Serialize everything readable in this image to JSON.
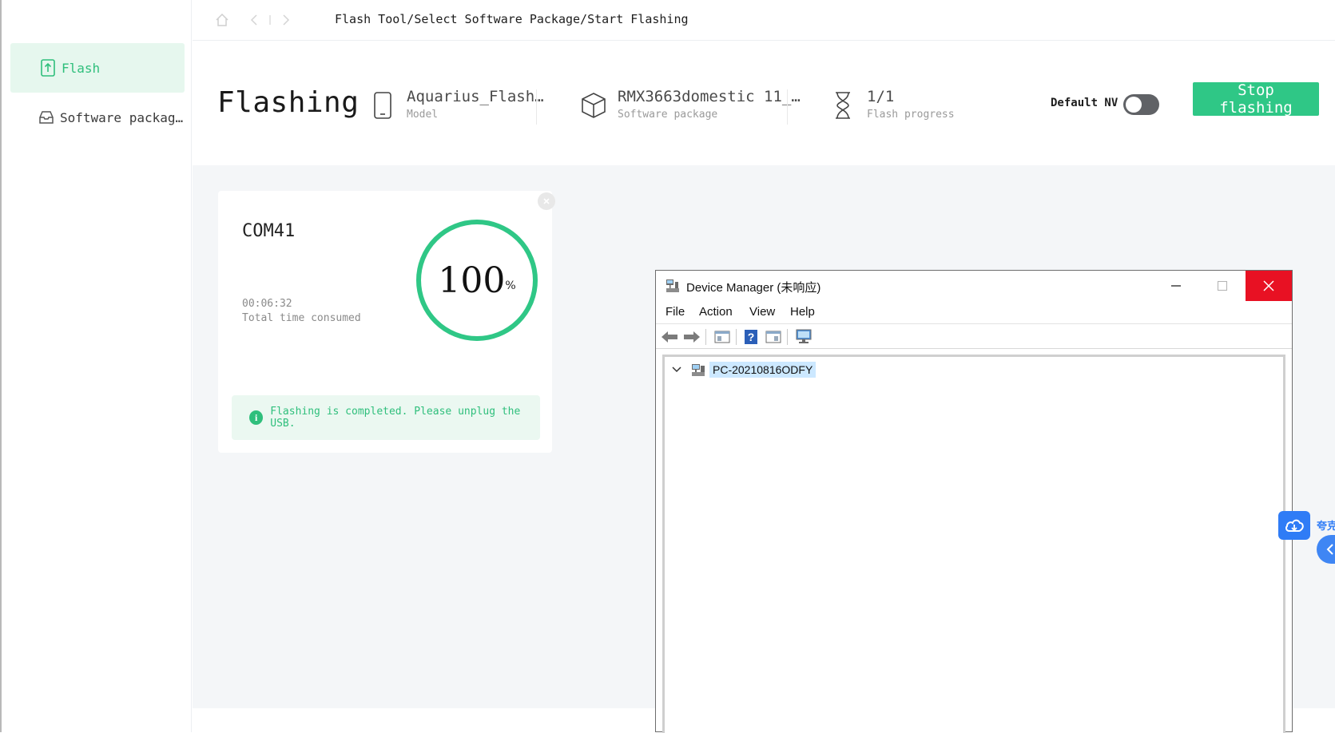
{
  "topbar": {
    "breadcrumb": "Flash Tool/Select Software Package/Start Flashing"
  },
  "sidebar": {
    "items": [
      {
        "label": "Flash",
        "active": true,
        "icon": "upload-file-icon"
      },
      {
        "label": "Software packag…",
        "active": false,
        "icon": "inbox-icon"
      }
    ]
  },
  "header": {
    "title": "Flashing",
    "model": {
      "value": "Aquarius_Flash…",
      "label": "Model"
    },
    "package": {
      "value": "RMX3663domestic 11_…",
      "label": "Software package"
    },
    "progress": {
      "value": "1/1",
      "label": "Flash progress"
    },
    "default_nv_label": "Default NV",
    "default_nv_on": false,
    "stop_button": "Stop flashing"
  },
  "card": {
    "port": "COM41",
    "time": "00:06:32",
    "time_label": "Total time consumed",
    "percent": "100",
    "percent_unit": "%",
    "notice": "Flashing is completed. Please unplug the USB."
  },
  "device_manager": {
    "title": "Device Manager (未响应)",
    "menu": [
      "File",
      "Action",
      "View",
      "Help"
    ],
    "tree_root": "PC-20210816ODFY"
  },
  "float_widget": {
    "text": "夸克"
  },
  "colors": {
    "accent_green": "#2fc786",
    "sidebar_active_bg": "#e6f7ee",
    "close_red": "#e81123",
    "selection_blue": "#cce8ff"
  }
}
